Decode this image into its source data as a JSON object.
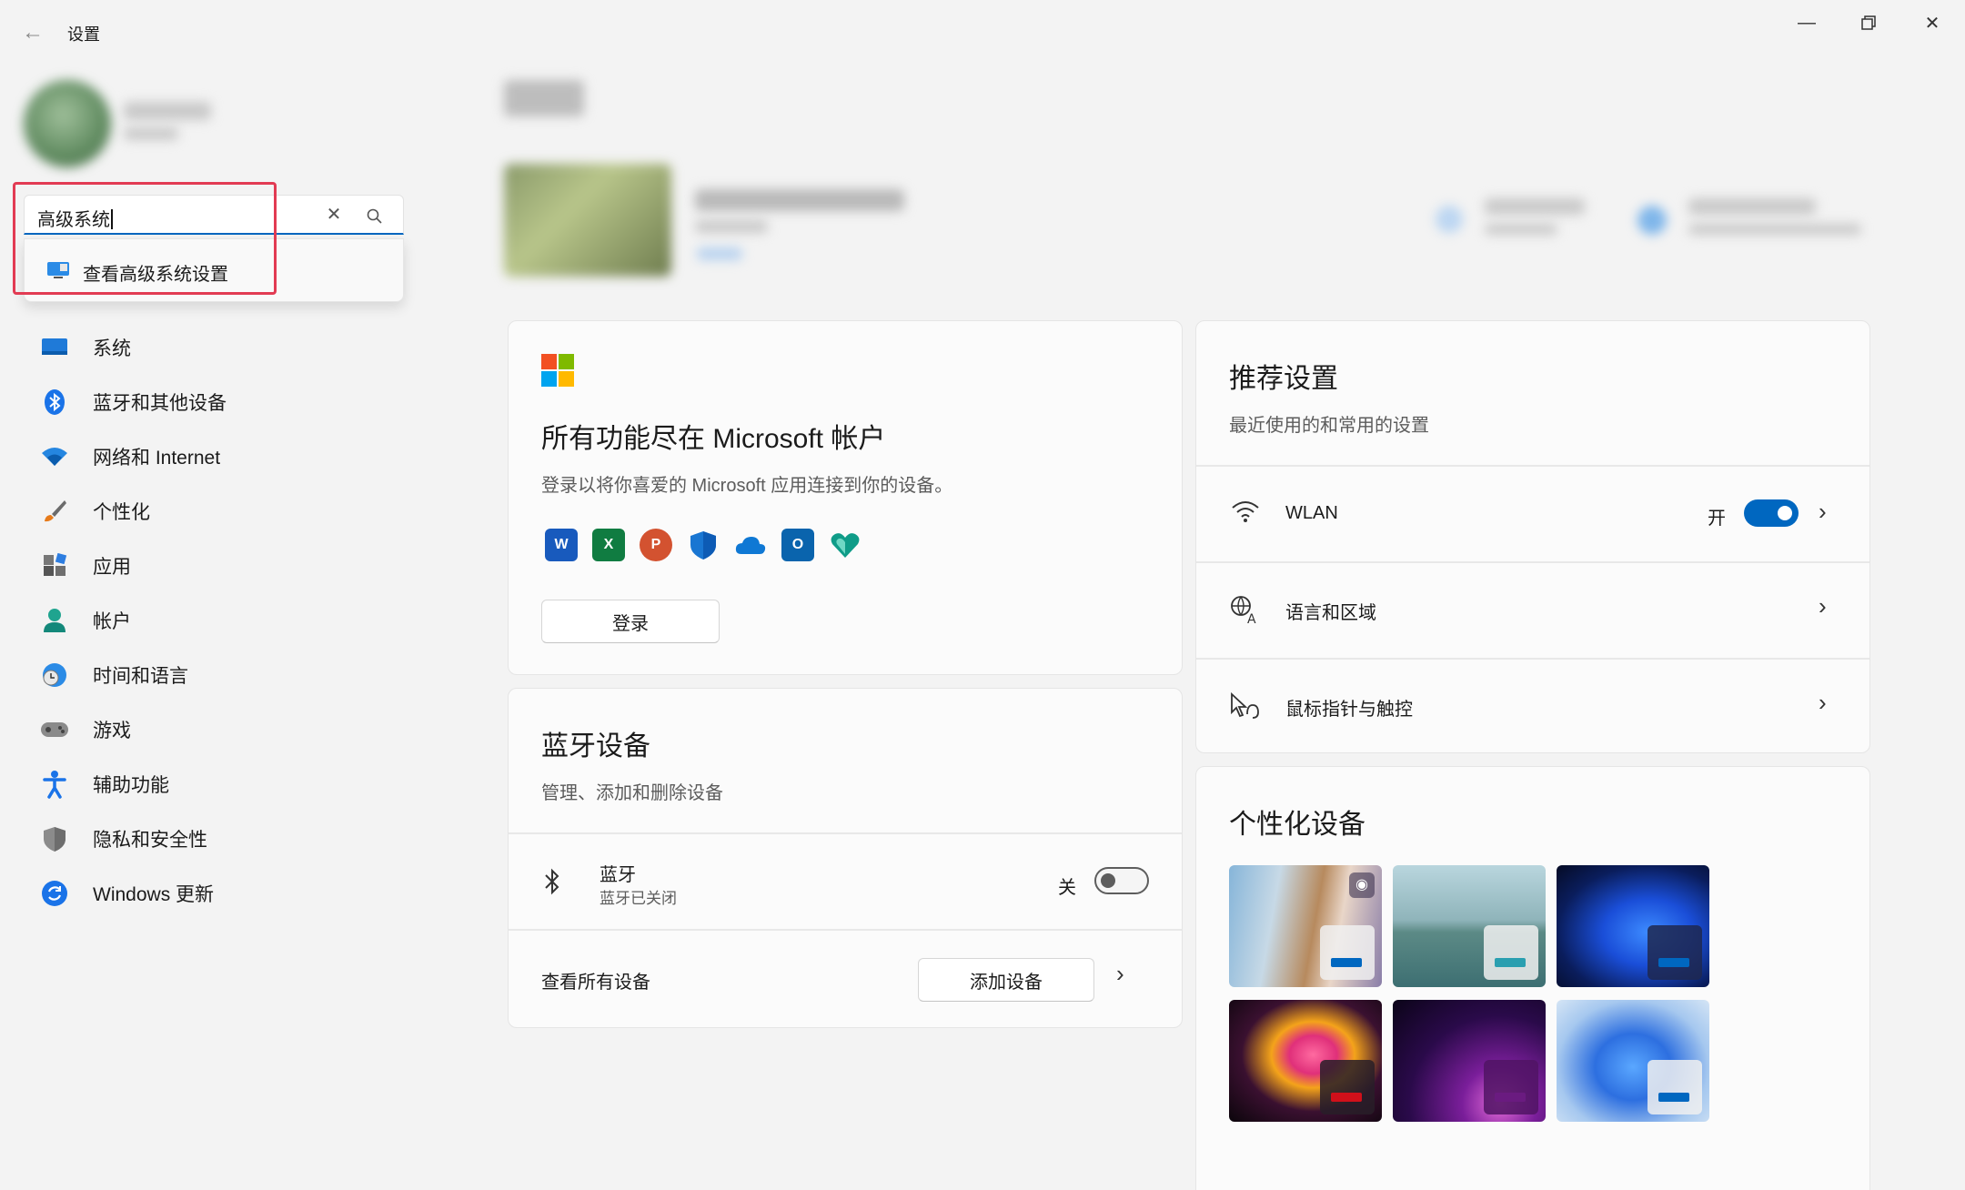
{
  "window": {
    "title": "设置",
    "back_icon": "back-arrow-icon",
    "controls": [
      "minimize-icon",
      "restore-icon",
      "close-icon"
    ]
  },
  "search": {
    "value": "高级系统",
    "suggestion": "查看高级系统设置"
  },
  "nav": {
    "items": [
      {
        "label": "系统",
        "icon": "system-icon"
      },
      {
        "label": "蓝牙和其他设备",
        "icon": "bluetooth-icon"
      },
      {
        "label": "网络和 Internet",
        "icon": "wifi-icon"
      },
      {
        "label": "个性化",
        "icon": "brush-icon"
      },
      {
        "label": "应用",
        "icon": "apps-icon"
      },
      {
        "label": "帐户",
        "icon": "account-icon"
      },
      {
        "label": "时间和语言",
        "icon": "time-language-icon"
      },
      {
        "label": "游戏",
        "icon": "gamepad-icon"
      },
      {
        "label": "辅助功能",
        "icon": "accessibility-icon"
      },
      {
        "label": "隐私和安全性",
        "icon": "shield-icon"
      },
      {
        "label": "Windows 更新",
        "icon": "update-icon"
      }
    ]
  },
  "ms_account_card": {
    "title": "所有功能尽在 Microsoft 帐户",
    "subtitle": "登录以将你喜爱的 Microsoft 应用连接到你的设备。",
    "signin_label": "登录",
    "apps": [
      "word",
      "excel",
      "powerpoint",
      "defender",
      "onedrive",
      "outlook",
      "family-safety"
    ]
  },
  "bluetooth_card": {
    "title": "蓝牙设备",
    "subtitle": "管理、添加和删除设备",
    "bt_label": "蓝牙",
    "bt_status": "蓝牙已关闭",
    "toggle_state": "关",
    "view_all": "查看所有设备",
    "add_device": "添加设备"
  },
  "recommended_card": {
    "title": "推荐设置",
    "subtitle": "最近使用的和常用的设置",
    "rows": [
      {
        "label": "WLAN",
        "state": "开"
      },
      {
        "label": "语言和区域"
      },
      {
        "label": "鼠标指针与触控"
      }
    ]
  },
  "personalize_card": {
    "title": "个性化设备",
    "themes": [
      {
        "accent": "#0067c0"
      },
      {
        "accent": "#2a9fb0"
      },
      {
        "accent": "#0067c0"
      },
      {
        "accent": "#d0101a"
      },
      {
        "accent": "#6a1b80"
      },
      {
        "accent": "#0067c0"
      }
    ]
  },
  "colors": {
    "accent": "#0067c0",
    "highlight_box": "#e23b53"
  }
}
